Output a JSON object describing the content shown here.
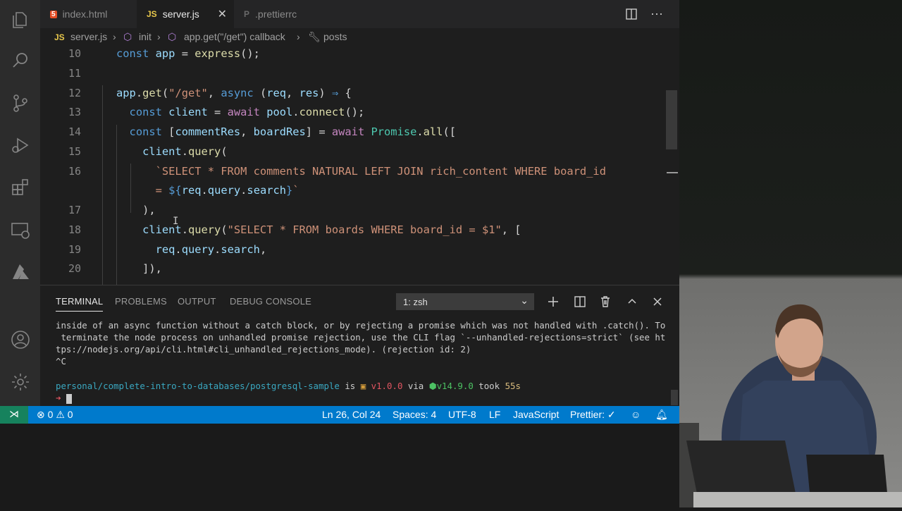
{
  "tabs": [
    {
      "icon": "5",
      "label": "index.html"
    },
    {
      "icon": "JS",
      "label": "server.js"
    },
    {
      "icon": "P",
      "label": ".prettierrc"
    }
  ],
  "breadcrumb": {
    "file_icon": "JS",
    "file": "server.js",
    "items": [
      "init",
      "app.get(\"/get\") callback",
      "posts"
    ],
    "sep": "›"
  },
  "editor": {
    "lines": [
      {
        "n": "10",
        "html": "<span class=\"dec\">const</span> <span class=\"var\">app</span> = <span class=\"fn\">express</span>();"
      },
      {
        "n": "11",
        "html": ""
      },
      {
        "n": "12",
        "html": "<span class=\"var\">app</span>.<span class=\"fn\">get</span>(<span class=\"str\">\"/get\"</span>, <span class=\"dec\">async</span> (<span class=\"var\">req</span>, <span class=\"var\">res</span>) <span class=\"dec\">⇒</span> {"
      },
      {
        "n": "13",
        "html": "  <span class=\"dec\">const</span> <span class=\"var\">client</span> = <span class=\"kw\">await</span> <span class=\"var\">pool</span>.<span class=\"fn\">connect</span>();"
      },
      {
        "n": "14",
        "html": "  <span class=\"dec\">const</span> [<span class=\"var\">commentRes</span>, <span class=\"var\">boardRes</span>] = <span class=\"kw\">await</span> <span class=\"cls\">Promise</span>.<span class=\"fn\">all</span>(["
      },
      {
        "n": "15",
        "html": "    <span class=\"var\">client</span>.<span class=\"fn\">query</span>("
      },
      {
        "n": "16",
        "html": "      <span class=\"str\">`SELECT * FROM comments NATURAL LEFT JOIN rich_content WHERE board_id</span>"
      },
      {
        "n": "",
        "html": "      <span class=\"str\">= </span><span class=\"dec\">${</span><span class=\"var\">req</span>.<span class=\"var\">query</span>.<span class=\"var\">search</span><span class=\"dec\">}</span><span class=\"str\">`</span>"
      },
      {
        "n": "17",
        "html": "    ),"
      },
      {
        "n": "18",
        "html": "    <span class=\"var\">client</span>.<span class=\"fn\">query</span>(<span class=\"str\">\"SELECT * FROM boards WHERE board_id = $1\"</span>, ["
      },
      {
        "n": "19",
        "html": "      <span class=\"var\">req</span>.<span class=\"var\">query</span>.<span class=\"var\">search</span>,"
      },
      {
        "n": "20",
        "html": "    ]),"
      }
    ]
  },
  "panel": {
    "tabs": [
      "TERMINAL",
      "PROBLEMS",
      "OUTPUT",
      "DEBUG CONSOLE"
    ],
    "terminal_select": "1: zsh",
    "terminal_lines": [
      "inside of an async function without a catch block, or by rejecting a promise which was not handled with .catch(). To",
      " terminate the node process on unhandled promise rejection, use the CLI flag `--unhandled-rejections=strict` (see ht",
      "tps://nodejs.org/api/cli.html#cli_unhandled_rejections_mode). (rejection id: 2)",
      "^C"
    ],
    "prompt": {
      "path": "personal/complete-intro-to-databases/postgresql-sample",
      "is": "is",
      "version": "v1.0.0",
      "via": "via",
      "node": "v14.9.0",
      "took": "took",
      "time": "55s",
      "arrow": "➜"
    }
  },
  "status": {
    "remote": "⋊",
    "errors": "0",
    "warnings": "0",
    "position": "Ln 26, Col 24",
    "spaces": "Spaces: 4",
    "encoding": "UTF-8",
    "eol": "LF",
    "language": "JavaScript",
    "prettier": "Prettier: ✓"
  },
  "colors": {
    "status_bar": "#007acc",
    "editor_bg": "#1e1e1e",
    "tab_bar": "#252526",
    "activity_bar": "#2c2c2c"
  }
}
